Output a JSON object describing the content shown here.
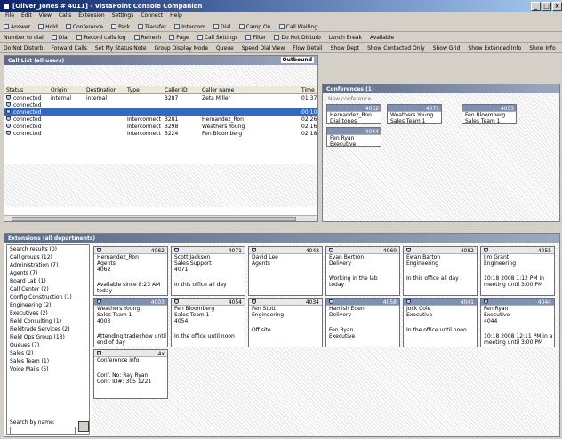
{
  "window": {
    "title": "[Oliver_Jones # 4011] - VistaPoint Console Companion",
    "buttons": [
      "_",
      "□",
      "×"
    ]
  },
  "menu": [
    "File",
    "Edit",
    "View",
    "Calls",
    "Extension",
    "Settings",
    "Connect",
    "Help"
  ],
  "toolbar1": [
    {
      "icon": "answer-icon",
      "label": "Answer"
    },
    {
      "icon": "hold-icon",
      "label": "Hold"
    },
    {
      "icon": "conference-icon",
      "label": "Conference"
    },
    {
      "icon": "park-icon",
      "label": "Park"
    },
    {
      "icon": "transfer-icon",
      "label": "Transfer"
    },
    {
      "icon": "intercom-icon",
      "label": "Intercom"
    },
    {
      "icon": "dial-icon",
      "label": "Dial"
    },
    {
      "icon": "camp-on-icon",
      "label": "Camp On"
    },
    {
      "icon": "call-waiting-icon",
      "label": "Call Waiting"
    }
  ],
  "toolbar2": [
    {
      "icon": "",
      "label": "Number to dial"
    },
    {
      "icon": "dial-icon",
      "label": "Dial"
    },
    {
      "icon": "record-icon",
      "label": "Record calls log"
    },
    {
      "icon": "refresh-icon",
      "label": "Refresh"
    },
    {
      "icon": "page-icon",
      "label": "Page"
    },
    {
      "icon": "settings-icon",
      "label": "Call Settings"
    },
    {
      "icon": "filter-icon",
      "label": "Filter"
    },
    {
      "icon": "dnd-icon",
      "label": "Do Not Disturb"
    },
    {
      "icon": "",
      "label": "Lunch Break"
    },
    {
      "icon": "",
      "label": "Available"
    }
  ],
  "toolbar3": [
    "Do Not Disturb",
    "Forward Calls",
    "Set My Status Note",
    "Group Display Mode",
    "Queue",
    "Speed Dial View",
    "Flow Detail",
    "Show Dept",
    "Show Contacted Only",
    "Show Grid",
    "Show Extended Info",
    "Show Info"
  ],
  "call_list": {
    "title": "Call List (all users)",
    "badge": "Outbound",
    "columns": [
      "Status",
      "Origin",
      "Destination",
      "Type",
      "Caller ID",
      "Caller name",
      "Time"
    ],
    "rows": [
      {
        "status": "connected",
        "origin": "internal",
        "destination": "internal",
        "type": "",
        "caller_id": "3287",
        "caller_name": "Zeta Miller",
        "time": "01:37",
        "selected": false
      },
      {
        "status": "connected",
        "origin": "",
        "destination": "",
        "type": "",
        "caller_id": "",
        "caller_name": "",
        "time": "",
        "selected": false
      },
      {
        "status": "connected",
        "origin": "",
        "destination": "",
        "type": "",
        "caller_id": "",
        "caller_name": "",
        "time": "00:10",
        "selected": true
      },
      {
        "status": "connected",
        "origin": "",
        "destination": "",
        "type": "Interconnect",
        "caller_id": "3281",
        "caller_name": "Hernandez_Ron",
        "time": "02:26",
        "selected": false
      },
      {
        "status": "connected",
        "origin": "",
        "destination": "",
        "type": "Interconnect",
        "caller_id": "3298",
        "caller_name": "Weathers Young",
        "time": "02:16",
        "selected": false
      },
      {
        "status": "connected",
        "origin": "",
        "destination": "",
        "type": "Interconnect",
        "caller_id": "3224",
        "caller_name": "Fen Bloomberg",
        "time": "02:18",
        "selected": false
      }
    ]
  },
  "conferences": {
    "title": "Conferences (1)",
    "toolbar": "New conference",
    "cards": [
      {
        "id": "4062",
        "lines": [
          "Hernandez_Ron",
          "Dial tones"
        ]
      },
      {
        "id": "4071",
        "lines": [
          "Weathers Young",
          "Sales Team 1"
        ]
      },
      {
        "id": "4053",
        "lines": [
          "Fen Bloomberg",
          "Sales Team 1"
        ]
      },
      {
        "id": "4044",
        "lines": [
          "Fen Ryan",
          "Executive"
        ]
      }
    ]
  },
  "extensions": {
    "title": "Extensions (all departments)",
    "departments": [
      "Search results (0)",
      "Call groups (12)",
      "Administration (7)",
      "Agents (7)",
      "Board Lab (1)",
      "Call Center (2)",
      "Config Construction (1)",
      "Engineering (2)",
      "Executives (2)",
      "Field Consulting (1)",
      "Fieldtrade Services (2)",
      "Field Ops Group (13)",
      "Queues (7)",
      "Sales (2)",
      "Sales Team (1)",
      "Voice Mails (5)"
    ],
    "search_label": "Search by name:",
    "cards": [
      {
        "id": "4062",
        "name": "Hernandez_Ron",
        "dept": "Agents",
        "ext": "4062",
        "note": "Available since 8:23 AM",
        "note2": "today",
        "dark": false
      },
      {
        "id": "4071",
        "name": "Scott Jackson",
        "dept": "Sales Support",
        "ext": "4071",
        "note": "In this office all day",
        "note2": "",
        "dark": false
      },
      {
        "id": "4043",
        "name": "David Lee",
        "dept": "Agents",
        "ext": "",
        "note": "",
        "note2": "",
        "dark": false
      },
      {
        "id": "4060",
        "name": "Evan Bertron",
        "dept": "Delivery",
        "ext": "",
        "note": "Working in the lab",
        "note2": "today",
        "dark": false
      },
      {
        "id": "4082",
        "name": "Ewan Barton",
        "dept": "Engineering",
        "ext": "",
        "note": "In this office all day",
        "note2": "",
        "dark": false
      },
      {
        "id": "4055",
        "name": "Jim Grant",
        "dept": "Engineering",
        "ext": "",
        "note": "10:18 2008 1:12 PM in",
        "note2": "meeting until 3:00 PM",
        "dark": false
      },
      {
        "id": "4003",
        "name": "Weathers Young",
        "dept": "Sales Team 1",
        "ext": "4003",
        "note": "Attending tradeshow until",
        "note2": "end of day",
        "dark": true
      },
      {
        "id": "4054",
        "name": "Fen Bloomberg",
        "dept": "Sales Team 1",
        "ext": "4054",
        "note": "In the office until noon",
        "note2": "",
        "dark": false
      },
      {
        "id": "4034",
        "name": "Fen Stott",
        "dept": "Engineering",
        "ext": "",
        "note": "Off site",
        "note2": "",
        "dark": false
      },
      {
        "id": "4058",
        "name": "Hamish Eden",
        "dept": "Delivery",
        "ext": "",
        "note": "Fen Ryan",
        "note2": "Executive",
        "dark": true
      },
      {
        "id": "4041",
        "name": "Jock Cole",
        "dept": "Executive",
        "ext": "",
        "note": "In the office until noon",
        "note2": "",
        "dark": true
      },
      {
        "id": "4044",
        "name": "Fen Ryan",
        "dept": "Executive",
        "ext": "4044",
        "note": "10:18 2008 12:11 PM in a",
        "note2": "meeting until 3:00 PM",
        "dark": true
      },
      {
        "id": "4x",
        "name": "Conference info",
        "dept": "",
        "ext": "",
        "note": "Conf. No: Ray Ryan",
        "note2": "Conf. ID#: 305 1221",
        "dark": false
      }
    ]
  },
  "colors": {
    "title_bar": "#0a246a",
    "panel_title": "#5a6a8a",
    "selection": "#316ac5"
  }
}
